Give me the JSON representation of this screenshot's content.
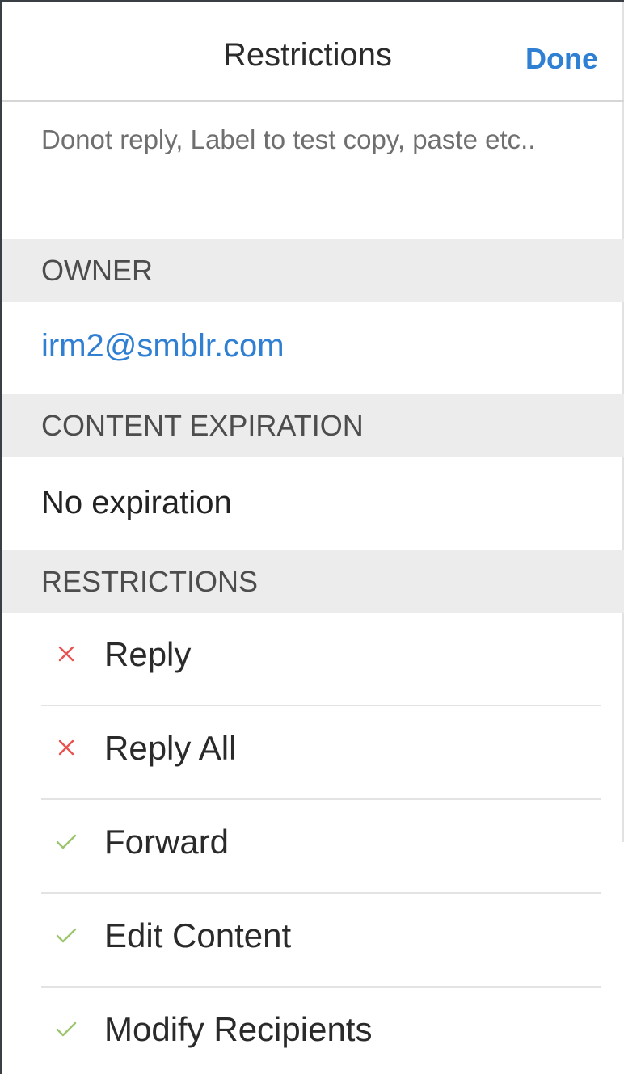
{
  "nav": {
    "title": "Restrictions",
    "done_label": "Done"
  },
  "description": "Donot reply, Label to test copy, paste etc..",
  "sections": {
    "owner": {
      "header": "OWNER",
      "value": "irm2@smblr.com"
    },
    "expiration": {
      "header": "CONTENT EXPIRATION",
      "value": "No expiration"
    },
    "restrictions": {
      "header": "RESTRICTIONS",
      "items": [
        {
          "label": "Reply",
          "allowed": false,
          "icon": "cross-icon"
        },
        {
          "label": "Reply All",
          "allowed": false,
          "icon": "cross-icon"
        },
        {
          "label": "Forward",
          "allowed": true,
          "icon": "check-icon"
        },
        {
          "label": "Edit Content",
          "allowed": true,
          "icon": "check-icon"
        },
        {
          "label": "Modify Recipients",
          "allowed": true,
          "icon": "check-icon"
        }
      ]
    }
  },
  "colors": {
    "accent": "#2f7fd2",
    "denied": "#e8514f",
    "allowed": "#9cc46b",
    "section_bg": "#ececec"
  }
}
